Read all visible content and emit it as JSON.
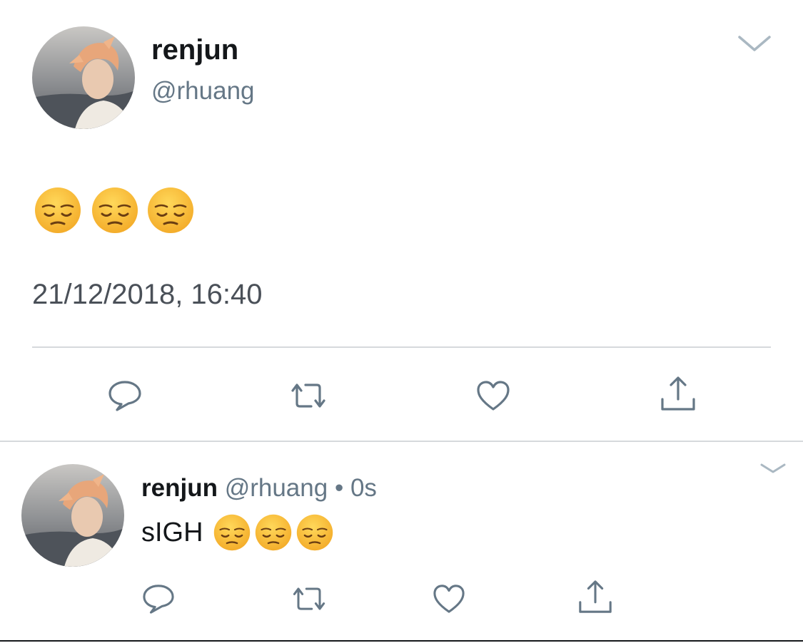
{
  "main_tweet": {
    "display_name": "renjun",
    "handle": "@rhuang",
    "text_emojis": [
      "pensive-face-emoji",
      "pensive-face-emoji",
      "pensive-face-emoji"
    ],
    "timestamp": "21/12/2018, 16:40",
    "menu_icon": "chevron-down-icon",
    "actions": [
      "reply-icon",
      "retweet-icon",
      "like-icon",
      "share-icon"
    ]
  },
  "reply_tweet": {
    "display_name": "renjun",
    "handle": "@rhuang",
    "separator": "•",
    "time": "0s",
    "text": "sIGH",
    "text_emojis": [
      "pensive-face-emoji",
      "pensive-face-emoji",
      "pensive-face-emoji"
    ],
    "menu_icon": "chevron-down-icon",
    "actions": [
      "reply-icon",
      "retweet-icon",
      "like-icon",
      "share-icon"
    ]
  },
  "colors": {
    "text": "#14171a",
    "muted": "#657786",
    "divider": "#d6d9dc",
    "icon": "#657786",
    "emoji_face": "#f7b733"
  }
}
